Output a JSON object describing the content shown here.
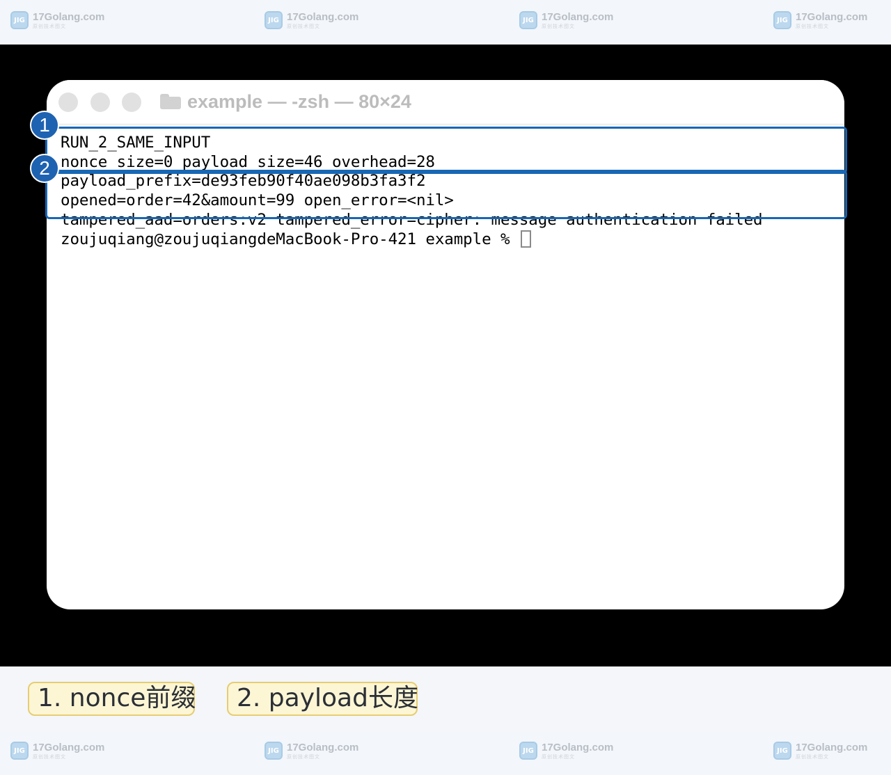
{
  "watermark": {
    "site": "17Golang.com",
    "tagline": "原创技术图文",
    "logo_glyph": "JIG"
  },
  "window": {
    "title": "example — -zsh — 80×24"
  },
  "terminal": {
    "lines": [
      "RUN_2_SAME_INPUT",
      "nonce_size=0 payload_size=46 overhead=28",
      "payload_prefix=de93feb90f40ae098b3fa3f2",
      "opened=order=42&amount=99 open_error=<nil>",
      "tampered_aad=orders:v2 tampered_error=cipher: message authentication failed"
    ],
    "prompt": "zoujuqiang@zoujuqiangdeMacBook-Pro-421 example % "
  },
  "annotations": {
    "badge_1": "1",
    "badge_2": "2",
    "label_1": "1. nonce前缀",
    "label_2": "2. payload长度",
    "highlight_color": "#1867b5"
  }
}
